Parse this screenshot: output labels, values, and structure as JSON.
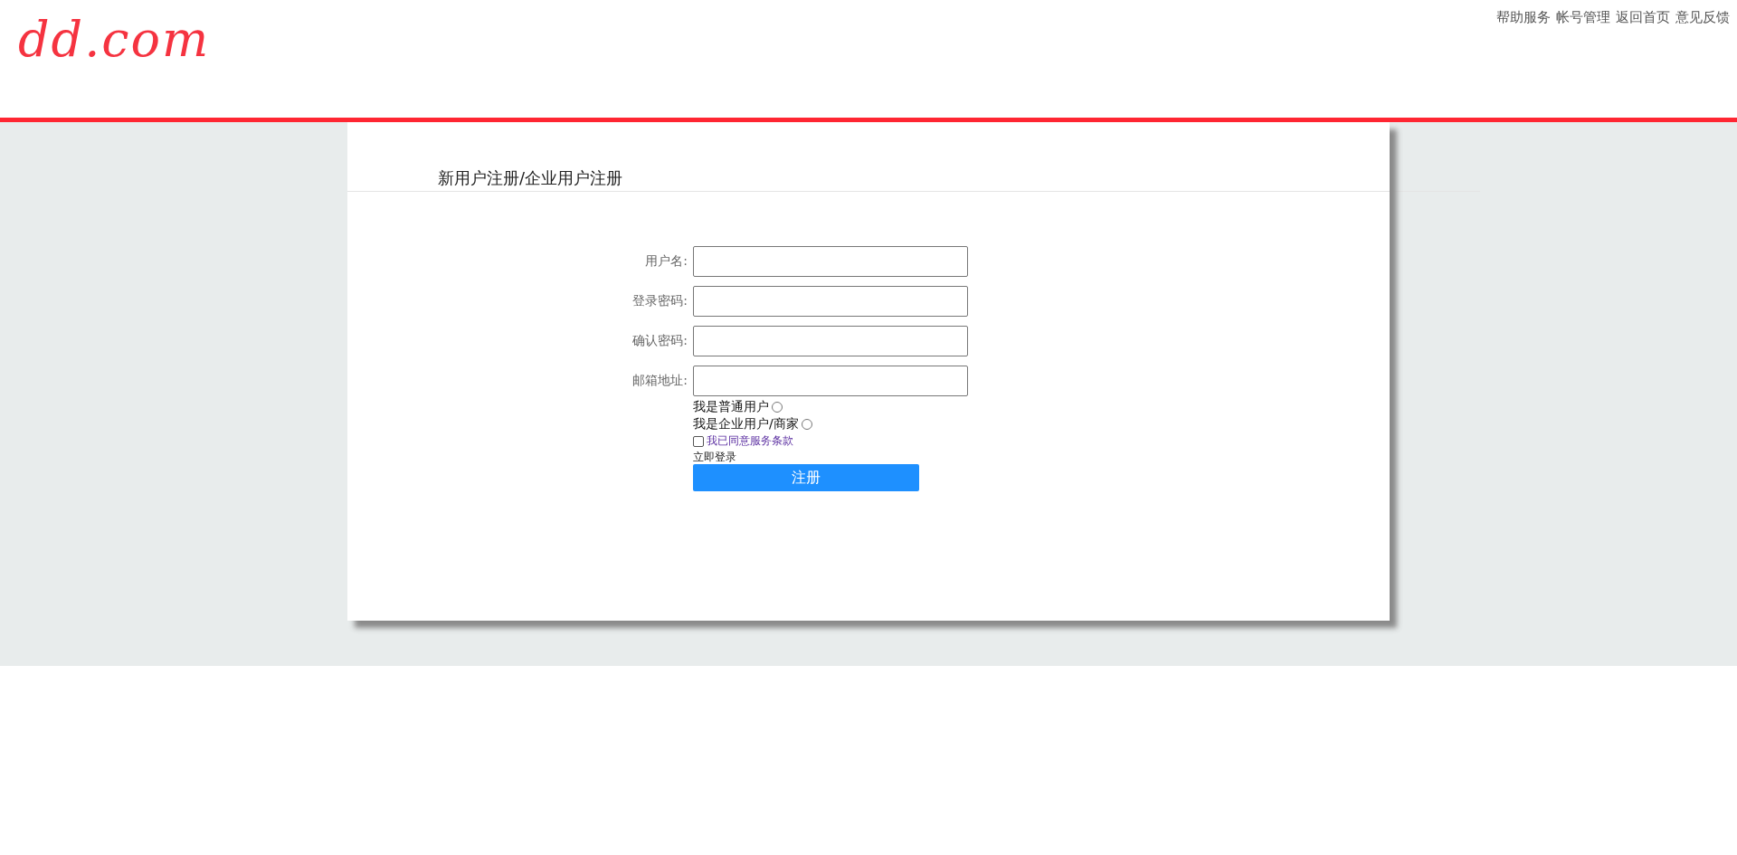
{
  "logo": "dd.com",
  "top_nav": [
    "帮助服务",
    "帐号管理",
    "返回首页",
    "意见反馈"
  ],
  "form": {
    "title": "新用户注册/企业用户注册",
    "fields": [
      {
        "label": "用户名:"
      },
      {
        "label": "登录密码:"
      },
      {
        "label": "确认密码:"
      },
      {
        "label": "邮箱地址:"
      }
    ],
    "user_types": [
      {
        "label": "我是普通用户",
        "selected": false
      },
      {
        "label": "我是企业用户/商家",
        "selected": false
      }
    ],
    "agree": {
      "label": "我已同意服务条款",
      "checked": false
    },
    "login_link": "立即登录",
    "submit": "注册"
  }
}
